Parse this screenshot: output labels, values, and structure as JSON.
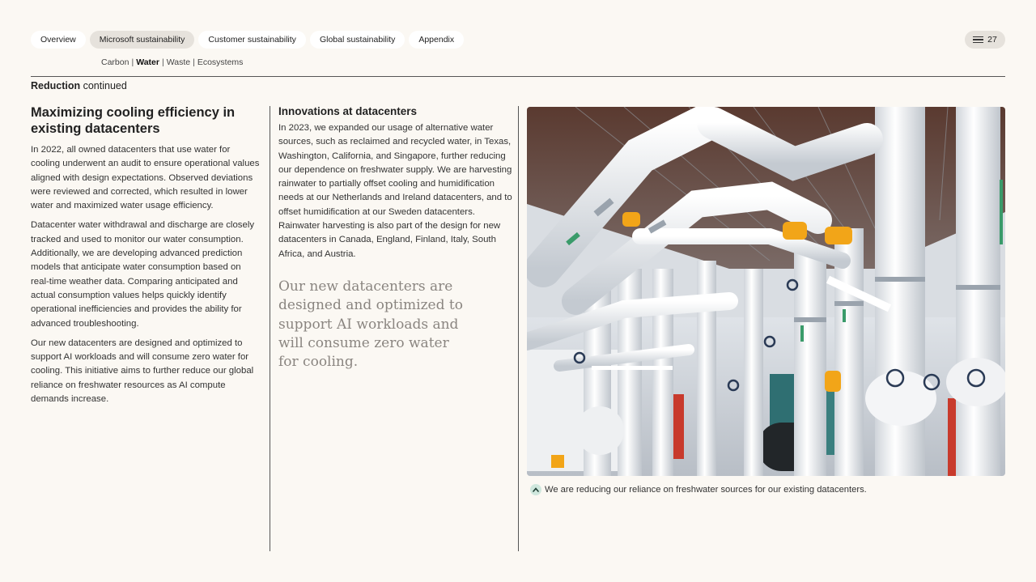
{
  "nav": {
    "tabs": [
      {
        "label": "Overview",
        "active": false
      },
      {
        "label": "Microsoft sustainability",
        "active": true
      },
      {
        "label": "Customer sustainability",
        "active": false
      },
      {
        "label": "Global sustainability",
        "active": false
      },
      {
        "label": "Appendix",
        "active": false
      }
    ],
    "page_number": "27",
    "menu_icon": "hamburger-menu-icon"
  },
  "subnav": {
    "items": [
      {
        "label": "Carbon",
        "current": false
      },
      {
        "label": "Water",
        "current": true
      },
      {
        "label": "Waste",
        "current": false
      },
      {
        "label": "Ecosystems",
        "current": false
      }
    ],
    "separator": "|"
  },
  "section": {
    "bold": "Reduction",
    "rest": " continued"
  },
  "column1": {
    "heading": "Maximizing cooling efficiency in existing datacenters",
    "paragraphs": [
      "In 2022, all owned datacenters that use water for cooling underwent an audit to ensure operational values aligned with design expectations. Observed deviations were reviewed and corrected, which resulted in lower water and maximized water usage efficiency.",
      "Datacenter water withdrawal and discharge are closely tracked and used to monitor our water consumption. Additionally, we are developing advanced prediction models that anticipate water consumption based on real-time weather data. Comparing anticipated and actual consumption values helps quickly identify operational inefficiencies and provides the ability for advanced troubleshooting.",
      "Our new datacenters are designed and optimized to support AI workloads and will consume zero water for cooling. This initiative aims to further reduce our global reliance on freshwater resources as AI compute demands increase."
    ]
  },
  "column2": {
    "heading": "Innovations at datacenters",
    "paragraph": "In 2023, we expanded our usage of alternative water sources, such as reclaimed and recycled water, in Texas, Washington, California, and Singapore, further reducing our dependence on freshwater supply. We are harvesting rainwater to partially offset cooling and humidification needs at our Netherlands and Ireland datacenters, and to offset humidification at our Sweden datacenters. Rainwater harvesting is also part of the design for new datacenters in Canada, England, Finland, Italy, South Africa, and Austria.",
    "pull_quote": "Our new datacenters are designed and optimized to support AI workloads and will consume zero water for cooling."
  },
  "photo": {
    "caption": "We are reducing our reliance on freshwater sources for our existing datacenters.",
    "caption_icon": "chevron-up-icon"
  },
  "colors": {
    "background": "#fbf8f3",
    "active_tab": "#e6e2dc",
    "quote_text": "#8a8580",
    "caption_icon_bg": "#cfe7dd"
  }
}
